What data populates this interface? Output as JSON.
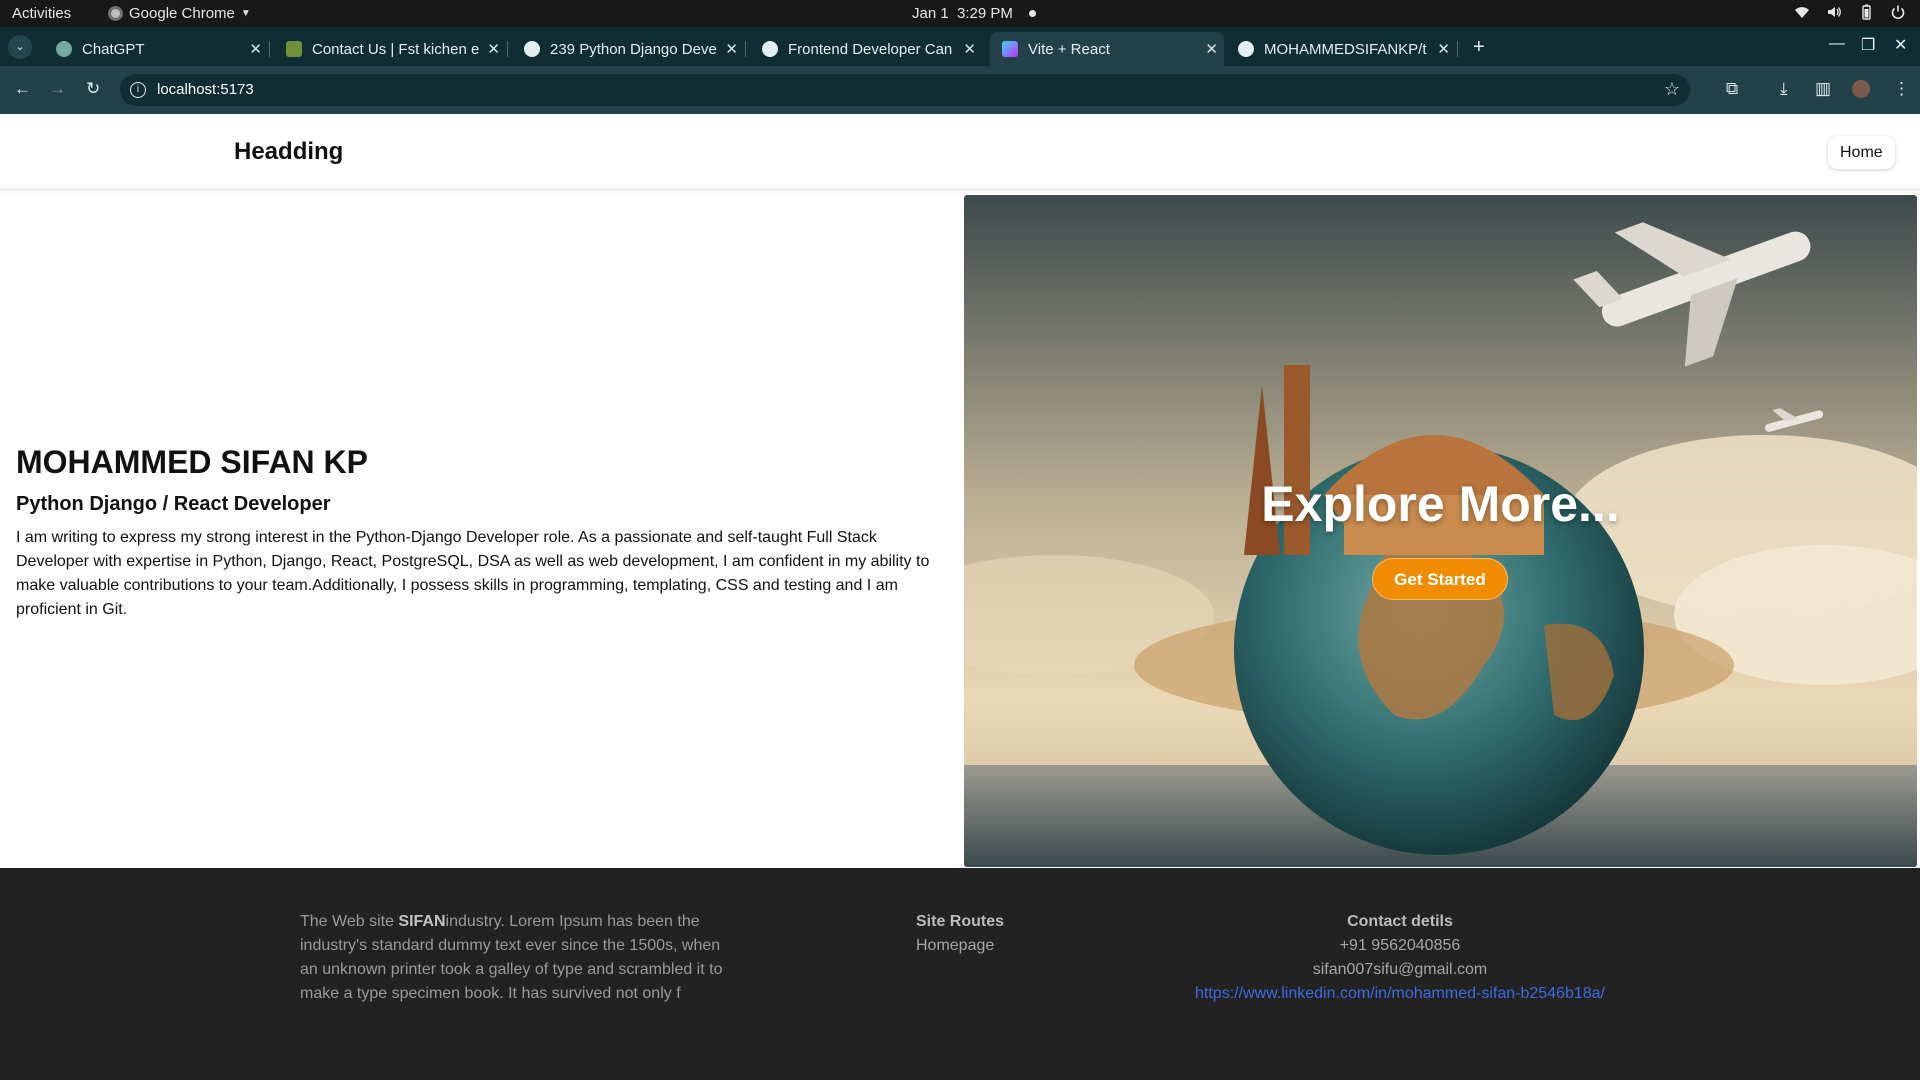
{
  "system_bar": {
    "activities": "Activities",
    "app_name": "Google Chrome",
    "app_menu_icon": "caret-down-icon",
    "date": "Jan 1",
    "time": "3:29 PM",
    "tray_icons": [
      "wifi-icon",
      "volume-icon",
      "battery-icon",
      "power-icon"
    ]
  },
  "browser": {
    "tabs": [
      {
        "title": "ChatGPT",
        "favicon_color": "#74aa9c",
        "active": false
      },
      {
        "title": "Contact Us | Fst kichen e",
        "favicon_color": "#6f8f3a",
        "active": false
      },
      {
        "title": "239 Python Django Deve",
        "favicon_color": "#e3eef0",
        "active": false
      },
      {
        "title": "Frontend Developer Can",
        "favicon_color": "#e3eef0",
        "active": false
      },
      {
        "title": "Vite + React",
        "favicon_color": "#a855f7",
        "active": true
      },
      {
        "title": "MOHAMMEDSIFANKP/t",
        "favicon_color": "#e3eef0",
        "active": false
      }
    ],
    "new_tab": "+",
    "url": "localhost:5173",
    "toolbar_icons": [
      "back-icon",
      "forward-icon",
      "reload-icon",
      "bookmark-star-icon",
      "extensions-icon",
      "download-icon",
      "side-panel-icon",
      "profile-avatar",
      "more-menu-icon"
    ]
  },
  "site": {
    "brand": "Headding",
    "nav_home": "Home",
    "intro": {
      "name": "MOHAMMED SIFAN KP",
      "role": "Python Django / React Developer",
      "paragraph": "I am writing to express my strong interest in the Python-Django Developer role. As a passionate and self-taught Full Stack Developer with expertise in Python, Django, React, PostgreSQL, DSA as well as web development, I am confident in my ability to make valuable contributions to your team.Additionally, I possess skills in programming, templating, CSS and testing and I am proficient in Git."
    },
    "hero": {
      "title": "Explore More...",
      "button": "Get Started",
      "accent": "#f08c00"
    },
    "footer": {
      "about_prefix": "The Web site ",
      "about_brand": "SIFAN",
      "about_text": "industry. Lorem Ipsum has been the industry's standard dummy text ever since the 1500s, when an unknown printer took a galley of type and scrambled it to make a type specimen book. It has survived not only f",
      "routes_heading": "Site Routes",
      "routes": [
        "Homepage"
      ],
      "contact_heading": "Contact detils",
      "phone": "+91 9562040856",
      "email": "sifan007sifu@gmail.com",
      "linkedin": "https://www.linkedin.com/in/mohammed-sifan-b2546b18a/"
    }
  }
}
